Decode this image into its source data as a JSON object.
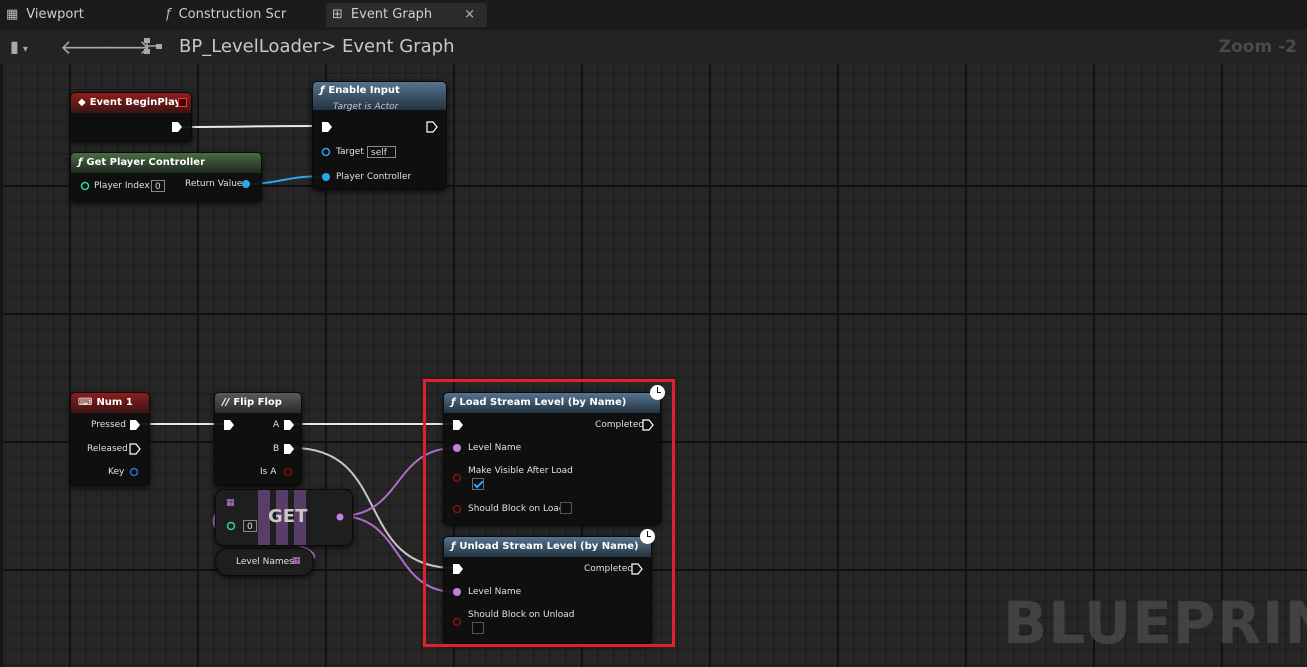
{
  "tabs": [
    {
      "label": "Viewport",
      "icon": "grid-icon"
    },
    {
      "label": "Construction Scr",
      "icon": "function-icon"
    },
    {
      "label": "Event Graph",
      "icon": "graph-icon",
      "close": "×"
    }
  ],
  "toolbar": {
    "breadcrumb_blueprint": "BP_LevelLoader",
    "breadcrumb_separator": ">",
    "breadcrumb_graph": "Event Graph",
    "zoom": "Zoom -2"
  },
  "nodes": {
    "event_begin_play": {
      "title": "Event BeginPlay"
    },
    "enable_input": {
      "title": "Enable Input",
      "subtitle": "Target is Actor",
      "target_label": "Target",
      "target_value": "self",
      "controller_label": "Player Controller"
    },
    "get_player_controller": {
      "title": "Get Player Controller",
      "index_label": "Player Index",
      "index_value": "0",
      "return_label": "Return Value"
    },
    "num1": {
      "title": "Num 1",
      "pressed": "Pressed",
      "released": "Released",
      "key": "Key"
    },
    "flip_flop": {
      "title": "Flip Flop",
      "a": "A",
      "b": "B",
      "is_a": "Is A"
    },
    "get": {
      "title": "GET",
      "index_value": "0"
    },
    "level_names": {
      "title": "Level Names"
    },
    "load_stream": {
      "title": "Load Stream Level (by Name)",
      "completed": "Completed",
      "level_name": "Level Name",
      "make_visible": "Make Visible After Load",
      "make_visible_checked": true,
      "should_block": "Should Block on Load",
      "should_block_checked": false
    },
    "unload_stream": {
      "title": "Unload Stream Level (by Name)",
      "completed": "Completed",
      "level_name": "Level Name",
      "should_block": "Should Block on Unload",
      "should_block_checked": false
    }
  },
  "watermark": "BLUEPRINT",
  "colors": {
    "exec": "#ffffff",
    "object": "#27a8ea",
    "int": "#2fd5a6",
    "name": "#c57ee4",
    "bool": "#8b1111",
    "struct": "#2573c9",
    "highlight": "#e0202d"
  }
}
